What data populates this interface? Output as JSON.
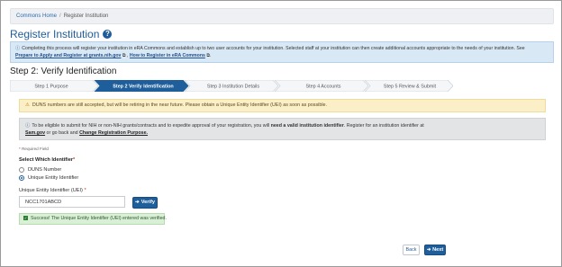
{
  "breadcrumb": {
    "home": "Commons Home",
    "separator": "/",
    "current": "Register Institution"
  },
  "page": {
    "title": "Register Institution",
    "help_icon": "question-circle-icon"
  },
  "info_banner": {
    "text": "Completing this process will register your institution in eRA Commons and establish up to two user accounts for your institution. Selected staff at your institution can then create additional accounts appropriate to the needs of your institution. See",
    "link1": "Prepare to Apply and Register at grants.nih.gov",
    "link2": "How to Register in eRA Commons"
  },
  "step_heading": "Step 2: Verify Identification",
  "steps": [
    {
      "label": "Step 1 Purpose",
      "active": false
    },
    {
      "label": "Step 2 Verify Identification",
      "active": true
    },
    {
      "label": "Step 3 Institution Details",
      "active": false
    },
    {
      "label": "Step 4 Accounts",
      "active": false
    },
    {
      "label": "Step 5 Review & Submit",
      "active": false
    }
  ],
  "warning_alert": "DUNS numbers are still accepted, but will be retiring in the near future. Please obtain a Unique Entity Identifier (UEI) as soon as possible.",
  "info_alert": {
    "part1": "To be eligible to submit for NIH or non-NIH grants/contracts and to expedite approval of your registration, you will ",
    "bold": "need a valid institution identifier",
    "part2": ". Register for an institution identifier at ",
    "link_sam": "Sam.gov",
    "part3": " or go back and ",
    "link_change": "Change Registration Purpose."
  },
  "required_note": "Required Field",
  "identifier": {
    "label": "Select Which Identifier",
    "options": [
      {
        "label": "DUNS Number",
        "selected": false
      },
      {
        "label": "Unique Entity Identifier",
        "selected": true
      }
    ]
  },
  "uei": {
    "label": "Unique Entity Identifier (UEI)",
    "value": "NCC1701ABCD"
  },
  "buttons": {
    "verify": "Verify",
    "back": "Back",
    "next": "Next"
  },
  "success_alert": "Success! The Unique Entity Identifier (UEI) entered was verified.",
  "colors": {
    "primary": "#1e5e9b",
    "warning_bg": "#fbefc8",
    "success_bg": "#d9efd6",
    "info_bg": "#d9e8f5"
  }
}
